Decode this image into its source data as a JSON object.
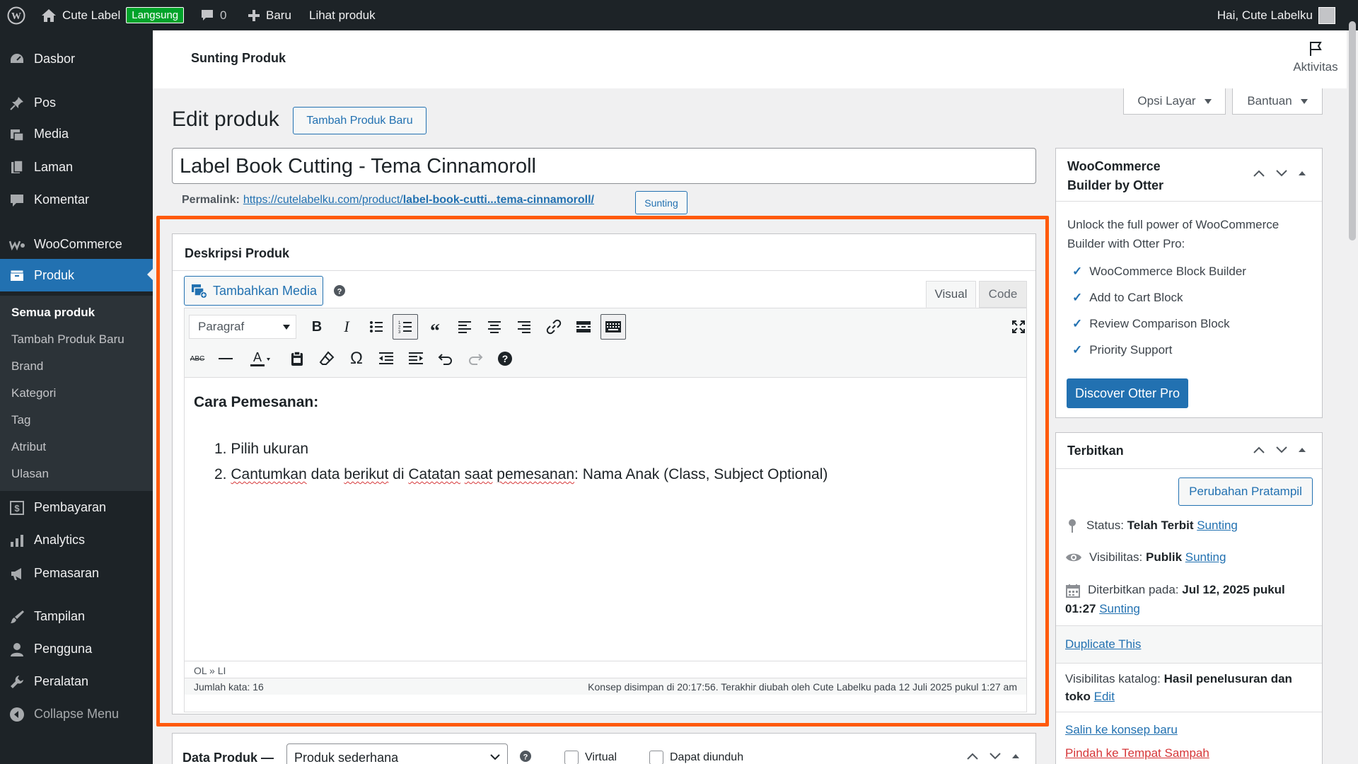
{
  "admin_bar": {
    "site_name": "Cute Label",
    "badge": "Langsung",
    "comments_count": "0",
    "new_label": "Baru",
    "view_product": "Lihat produk",
    "greeting": "Hai, Cute Labelku"
  },
  "sidebar": {
    "items": [
      {
        "label": "Dasbor",
        "icon": "dashboard-icon"
      },
      {
        "label": "Pos",
        "icon": "pin-icon"
      },
      {
        "label": "Media",
        "icon": "media-icon"
      },
      {
        "label": "Laman",
        "icon": "page-icon"
      },
      {
        "label": "Komentar",
        "icon": "comment-icon"
      },
      {
        "label": "WooCommerce",
        "icon": "woocommerce-icon"
      },
      {
        "label": "Produk",
        "icon": "archive-icon"
      },
      {
        "label": "Pembayaran",
        "icon": "payment-icon"
      },
      {
        "label": "Analytics",
        "icon": "chart-icon"
      },
      {
        "label": "Pemasaran",
        "icon": "megaphone-icon"
      },
      {
        "label": "Tampilan",
        "icon": "brush-icon"
      },
      {
        "label": "Pengguna",
        "icon": "user-icon"
      },
      {
        "label": "Peralatan",
        "icon": "wrench-icon"
      },
      {
        "label": "Collapse Menu",
        "icon": "collapse-icon"
      }
    ],
    "submenu": [
      "Semua produk",
      "Tambah Produk Baru",
      "Brand",
      "Kategori",
      "Tag",
      "Atribut",
      "Ulasan"
    ]
  },
  "header": {
    "title": "Sunting Produk",
    "activity": "Aktivitas"
  },
  "screen_options": "Opsi Layar",
  "help": "Bantuan",
  "page": {
    "heading": "Edit produk",
    "add_new": "Tambah Produk Baru",
    "product_title": "Label Book Cutting - Tema Cinnamoroll",
    "permalink_label": "Permalink:",
    "permalink_base": "https://cutelabelku.com/product/",
    "permalink_slug": "label-book-cutti...tema-cinnamoroll/",
    "permalink_edit": "Sunting"
  },
  "editor": {
    "box_title": "Deskripsi Produk",
    "add_media": "Tambahkan Media",
    "tab_visual": "Visual",
    "tab_code": "Code",
    "format_select": "Paragraf",
    "content_heading": "Cara Pemesanan:",
    "list_item_1": "Pilih ukuran",
    "list_item_2": {
      "w1": "Cantumkan",
      "t1": " data ",
      "w2": "berikut",
      "t2": " di ",
      "w3": "Catatan",
      "t3": " ",
      "w4": "saat",
      "t4": " ",
      "w5": "pemesanan",
      "t5": ": Nama Anak (Class, Subject Optional)"
    },
    "path": "OL » LI",
    "word_count": "Jumlah kata: 16",
    "autosave": "Konsep disimpan di 20:17:56. Terakhir diubah oleh Cute Labelku pada 12 Juli 2025 pukul 1:27 am"
  },
  "otter": {
    "title_line1": "WooCommerce",
    "title_line2": "Builder by Otter",
    "description": "Unlock the full power of WooCommerce Builder with Otter Pro:",
    "features": [
      "WooCommerce Block Builder",
      "Add to Cart Block",
      "Review Comparison Block",
      "Priority Support"
    ],
    "cta": "Discover Otter Pro"
  },
  "publish": {
    "title": "Terbitkan",
    "preview": "Perubahan Pratampil",
    "status_label": "Status:",
    "status_value": "Telah Terbit",
    "visibility_label": "Visibilitas:",
    "visibility_value": "Publik",
    "published_label": "Diterbitkan pada:",
    "published_value_1": "Jul 12, 2025 pukul",
    "published_value_2": "01:27",
    "edit": "Sunting",
    "duplicate": "Duplicate This",
    "catalog_label": "Visibilitas katalog:",
    "catalog_value_1": "Hasil penelusuran dan",
    "catalog_value_2": "toko",
    "catalog_edit": "Edit",
    "copy_draft": "Salin ke konsep baru",
    "trash": "Pindah ke Tempat Sampah"
  },
  "product_data": {
    "title": "Data Produk —",
    "type": "Produk sederhana",
    "virtual": "Virtual",
    "downloadable": "Dapat diunduh"
  },
  "colors": {
    "accent": "#2271b1",
    "highlight": "#ff5a0a",
    "live": "#00a32a",
    "trash": "#d63638"
  }
}
